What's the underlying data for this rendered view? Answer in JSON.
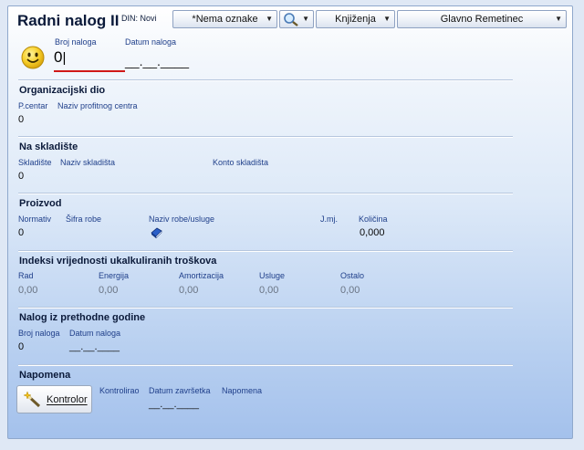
{
  "header": {
    "title": "Radni nalog II",
    "din_label": "DIN: Novi",
    "tag_combo": "*Nema oznake",
    "knjizenja_combo": "Knjiženja",
    "location_combo": "Glavno Remetinec"
  },
  "order": {
    "number_label": "Broj naloga",
    "number_value": "0",
    "date_label": "Datum naloga",
    "date_value": "__.__.____"
  },
  "org": {
    "title": "Organizacijski dio",
    "pcentar_label": "P.centar",
    "pcentar_value": "0",
    "profit_center_name_label": "Naziv profitnog centra"
  },
  "warehouse": {
    "title": "Na skladište",
    "warehouse_label": "Skladište",
    "warehouse_value": "0",
    "warehouse_name_label": "Naziv skladišta",
    "account_label": "Konto skladišta"
  },
  "product": {
    "title": "Proizvod",
    "normativ_label": "Normativ",
    "normativ_value": "0",
    "sifra_label": "Šifra robe",
    "name_label": "Naziv robe/usluge",
    "unit_label": "J.mj.",
    "qty_label": "Količina",
    "qty_value": "0,000"
  },
  "indices": {
    "title": "Indeksi vrijednosti ukalkuliranih troškova",
    "items": [
      {
        "label": "Rad",
        "value": "0,00"
      },
      {
        "label": "Energija",
        "value": "0,00"
      },
      {
        "label": "Amortizacija",
        "value": "0,00"
      },
      {
        "label": "Usluge",
        "value": "0,00"
      },
      {
        "label": "Ostalo",
        "value": "0,00"
      }
    ]
  },
  "prev_year": {
    "title": "Nalog iz prethodne godine",
    "number_label": "Broj naloga",
    "number_value": "0",
    "date_label": "Datum naloga",
    "date_value": "__.__.____"
  },
  "note": {
    "title": "Napomena",
    "controller_button": "Kontrolor",
    "controlled_label": "Kontrolirao",
    "end_date_label": "Datum završetka",
    "end_date_value": "__.__.____",
    "note_label": "Napomena"
  },
  "icons": {
    "smiley": "smiley-icon",
    "search": "magnifier-icon",
    "book": "book-icon",
    "wand": "wand-icon"
  }
}
